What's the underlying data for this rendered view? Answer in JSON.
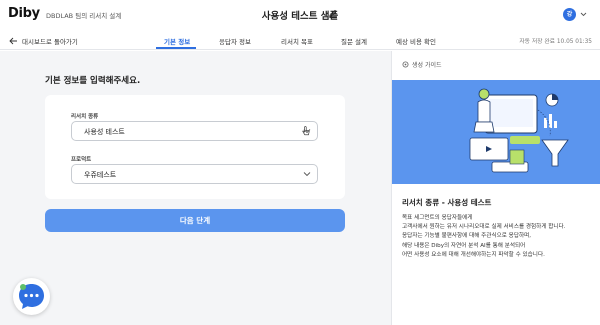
{
  "app": {
    "logo": "Diby",
    "subtitle": "DBDLAB 팀의 리서치 설계",
    "project_title": "사용성 테스트 샘플",
    "avatar_initial": "강"
  },
  "nav": {
    "back_label": "대시보드로 돌아가기",
    "tabs": [
      {
        "label": "기본 정보",
        "active": true
      },
      {
        "label": "응답자 정보",
        "active": false
      },
      {
        "label": "리서치 목표",
        "active": false
      },
      {
        "label": "질문 설계",
        "active": false
      },
      {
        "label": "예상 비용 확인",
        "active": false
      }
    ],
    "autosave": "자동 저장 완료 10.05 01:35"
  },
  "form": {
    "heading": "기본 정보를 입력해주세요.",
    "research_type": {
      "label": "리서치 종류",
      "value": "사용성 테스트"
    },
    "product": {
      "label": "프로덕트",
      "value": "우쥬테스트"
    },
    "next_button": "다음 단계"
  },
  "guide": {
    "header": "생성 가이드",
    "title": "리서치 종류 - 사용성 테스트",
    "lines": [
      "목표 세그먼트의 응답자들에게",
      "고객사에서 원하는 유저 시나리오대로 실제 서비스를 경험하게 합니다.",
      "응답자는 기능별 불편사항에 대해 주관식으로 응답하며,",
      "해당 내용은 Diby의 자연어 분석 AI를 통해 분석되어",
      "어떤 사용성 요소에 대해 개선해야하는지 파악할 수 있습니다."
    ]
  },
  "colors": {
    "accent": "#2f6fe0",
    "button": "#5b95ee",
    "illustration_bg": "#5b95ee",
    "background": "#f4f5f7"
  },
  "icons": {
    "edit": "pencil-icon",
    "back": "arrow-left-icon",
    "chevron": "chevron-down-icon",
    "guide": "gear-icon",
    "chat": "chat-bubble-icon",
    "cursor": "hand-pointer-icon"
  }
}
